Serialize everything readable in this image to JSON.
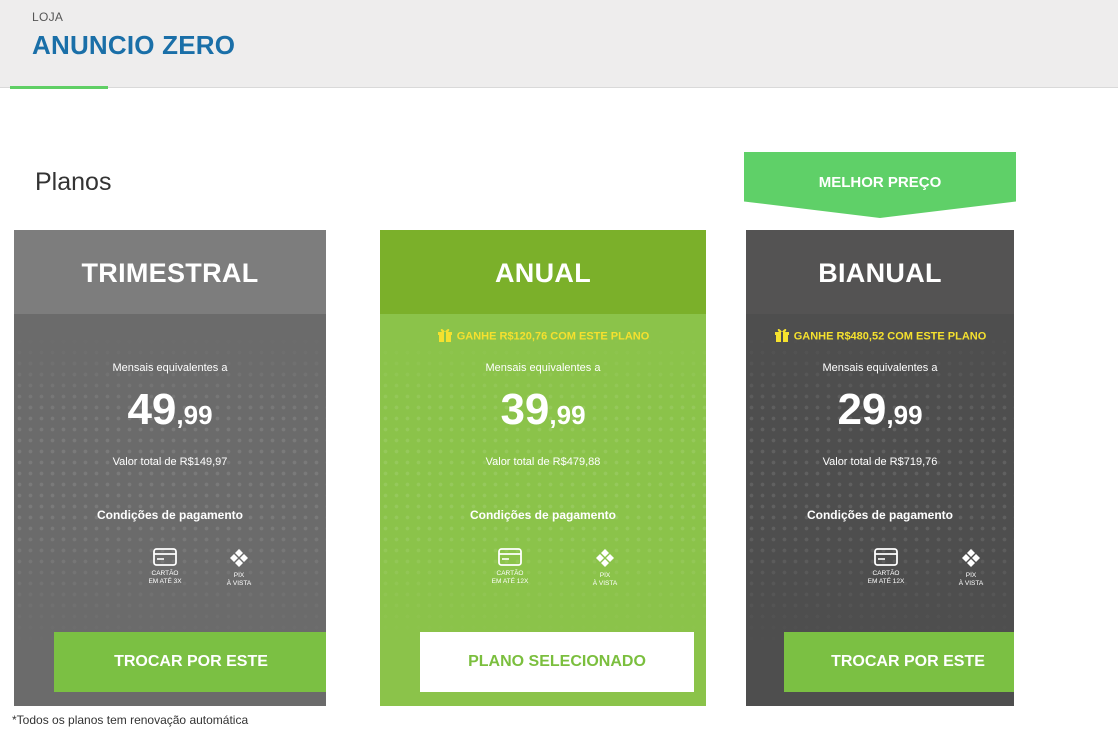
{
  "header": {
    "kicker": "LOJA",
    "store_name": "ANUNCIO ZERO"
  },
  "section_title": "Planos",
  "best_price_label": "MELHOR PREÇO",
  "plans": [
    {
      "name": "TRIMESTRAL",
      "bonus": "",
      "equiv_label": "Mensais equivalentes a",
      "price_int": "49",
      "price_dec": ",99",
      "total": "Valor total de R$149,97",
      "conditions": "Condições de pagamento",
      "card_line1": "CARTÃO",
      "card_line2": "EM ATÉ 3X",
      "pix_line1": "PIX",
      "pix_line2": "À VISTA",
      "button": "TROCAR POR ESTE",
      "selected": false
    },
    {
      "name": "ANUAL",
      "bonus": "GANHE R$120,76 COM ESTE PLANO",
      "equiv_label": "Mensais equivalentes a",
      "price_int": "39",
      "price_dec": ",99",
      "total": "Valor total de R$479,88",
      "conditions": "Condições de pagamento",
      "card_line1": "CARTÃO",
      "card_line2": "EM ATÉ 12X",
      "pix_line1": "PIX",
      "pix_line2": "À VISTA",
      "button": "PLANO SELECIONADO",
      "selected": true
    },
    {
      "name": "BIANUAL",
      "bonus": "GANHE R$480,52 COM ESTE PLANO",
      "equiv_label": "Mensais equivalentes a",
      "price_int": "29",
      "price_dec": ",99",
      "total": "Valor total de R$719,76",
      "conditions": "Condições de pagamento",
      "card_line1": "CARTÃO",
      "card_line2": "EM ATÉ 12X",
      "pix_line1": "PIX",
      "pix_line2": "À VISTA",
      "button": "TROCAR POR ESTE",
      "selected": false
    }
  ],
  "footnote": "*Todos os planos tem renovação automática",
  "colors": {
    "brand_blue": "#1a6fa8",
    "accent_green": "#5fd068",
    "button_green": "#7bc043",
    "bonus_yellow": "#f5e12e"
  },
  "icons": {
    "bonus": "gift-icon",
    "card": "credit-card-icon",
    "pix": "pix-icon"
  }
}
